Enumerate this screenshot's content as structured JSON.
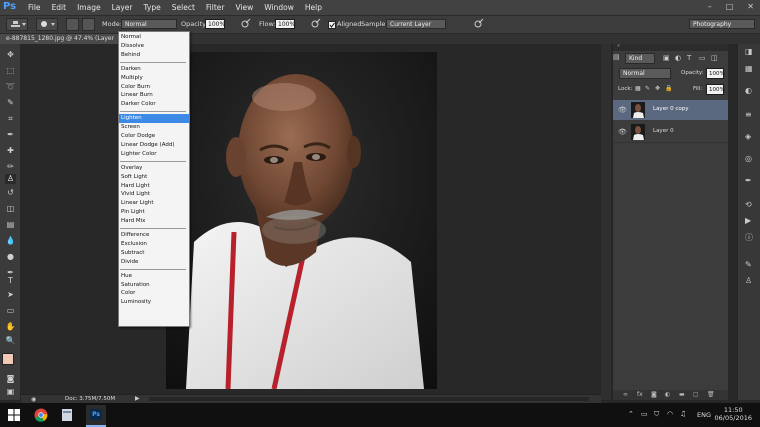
{
  "app": {
    "logo": "Ps",
    "menus": [
      "File",
      "Edit",
      "Image",
      "Layer",
      "Type",
      "Select",
      "Filter",
      "View",
      "Window",
      "Help"
    ],
    "window_controls": [
      "–",
      "□",
      "✕"
    ]
  },
  "options_bar": {
    "mode_label": "Mode:",
    "mode_value": "Normal",
    "opacity_label": "Opacity:",
    "opacity_value": "100%",
    "flow_label": "Flow:",
    "flow_value": "100%",
    "aligned_label": "Aligned",
    "sample_label": "Sample:",
    "sample_value": "Current Layer",
    "workspace": "Photography"
  },
  "document_tab": {
    "title": "e-887815_1280.jpg @ 47.4% (Layer"
  },
  "blend_modes": [
    [
      "Normal",
      "Dissolve",
      "Behind"
    ],
    [
      "Darken",
      "Multiply",
      "Color Burn",
      "Linear Burn",
      "Darker Color"
    ],
    [
      "Lighten",
      "Screen",
      "Color Dodge",
      "Linear Dodge (Add)",
      "Lighter Color"
    ],
    [
      "Overlay",
      "Soft Light",
      "Hard Light",
      "Vivid Light",
      "Linear Light",
      "Pin Light",
      "Hard Mix"
    ],
    [
      "Difference",
      "Exclusion",
      "Subtract",
      "Divide"
    ],
    [
      "Hue",
      "Saturation",
      "Color",
      "Luminosity"
    ]
  ],
  "selected_blend_mode": "Lighten",
  "status_bar": {
    "doc": "Doc: 3.75M/7.50M"
  },
  "layers_panel": {
    "kind_label": "Kind",
    "blend": "Normal",
    "opacity_label": "Opacity:",
    "opacity_value": "100%",
    "lock_label": "Lock:",
    "fill_label": "Fill:",
    "fill_value": "100%",
    "layers": [
      {
        "name": "Layer 0 copy",
        "selected": true
      },
      {
        "name": "Layer 0",
        "selected": false
      }
    ]
  },
  "taskbar": {
    "language": "ENG",
    "time": "11:50",
    "date": "06/05/2016"
  },
  "colors": {
    "accent": "#3d8ae6",
    "foreground_swatch": "#f2c9b6",
    "background_swatch": "#ffffff"
  }
}
